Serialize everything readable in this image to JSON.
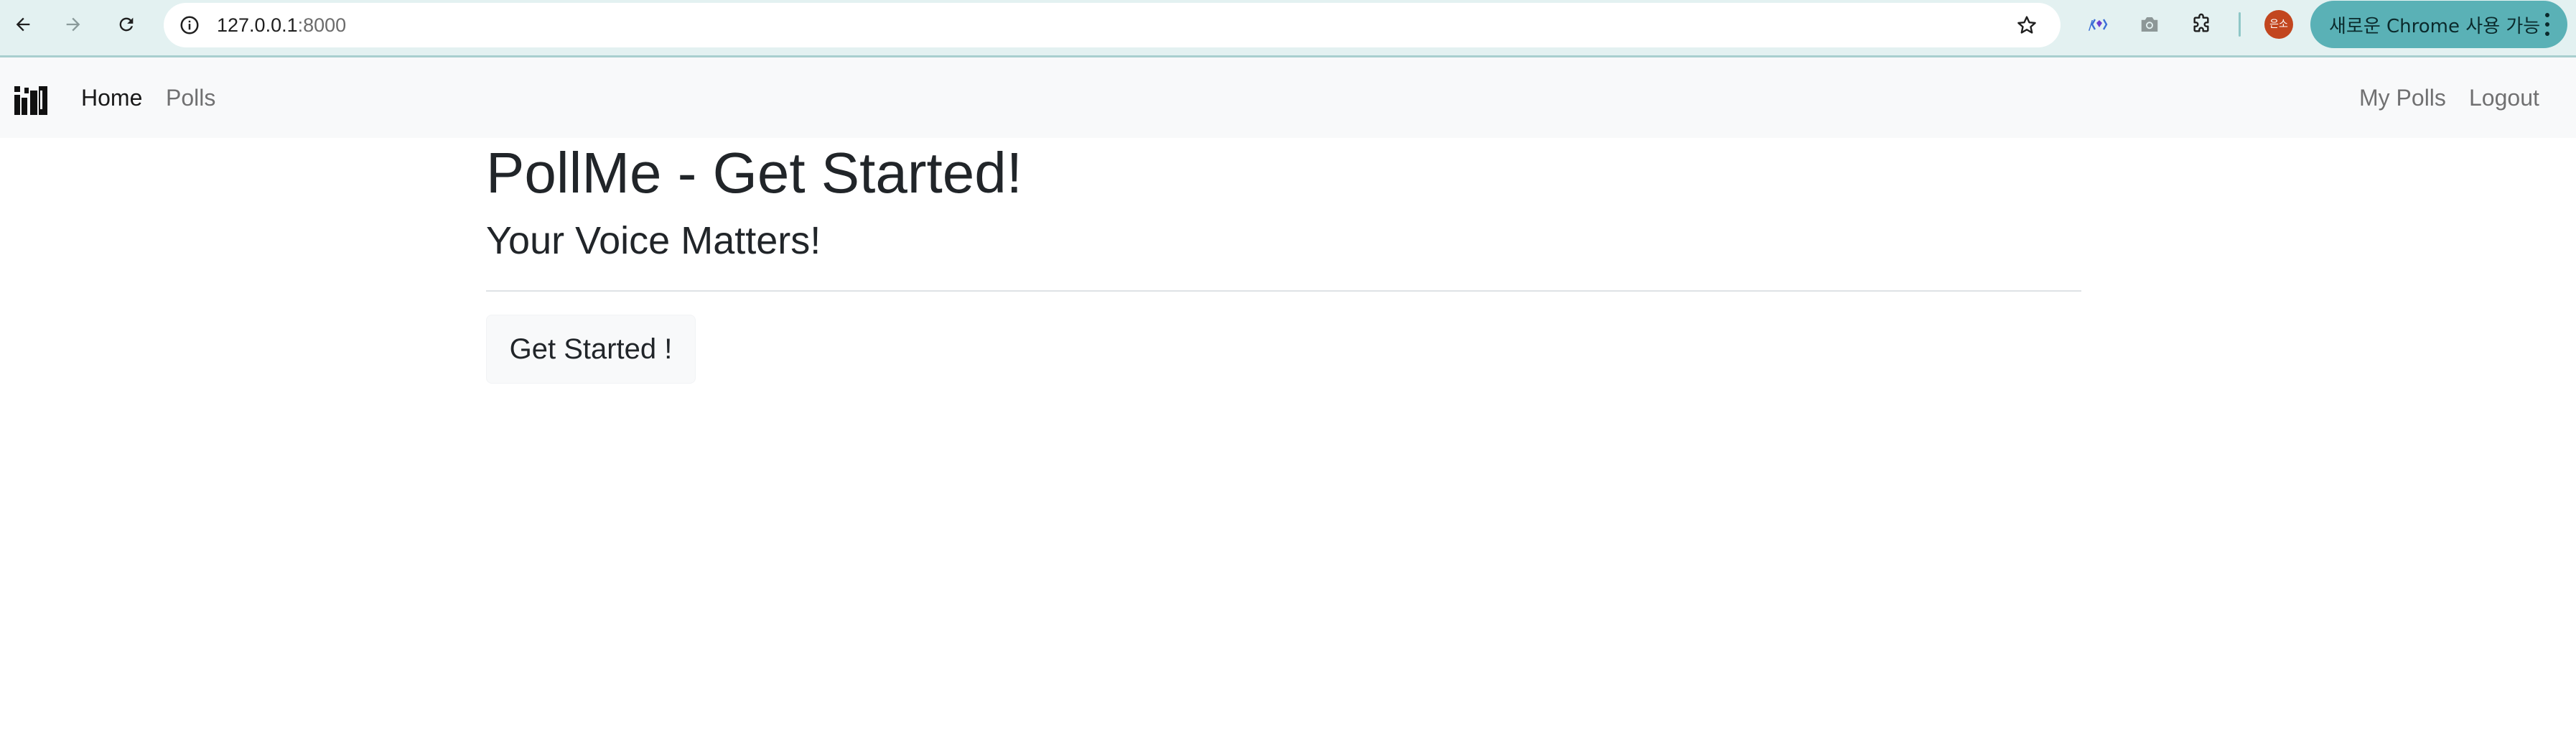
{
  "browser": {
    "url_host": "127.0.0.1",
    "url_port": ":8000",
    "profile_initials": "은소",
    "update_label": "새로운 Chrome 사용 가능",
    "icons": {
      "back": "arrow-left-icon",
      "forward": "arrow-right-icon",
      "reload": "reload-icon",
      "site_info": "info-icon",
      "bookmark": "star-icon",
      "extension_1": "code-extension-icon",
      "extension_2": "camera-icon",
      "extensions": "puzzle-icon",
      "menu": "kebab-menu-icon"
    },
    "colors": {
      "toolbar": "#e3f1f1",
      "update_pill": "#5ab1b6",
      "profile": "#c2461f"
    }
  },
  "navbar": {
    "brand_icon": "poll-logo-icon",
    "left_links": [
      {
        "label": "Home",
        "active": true
      },
      {
        "label": "Polls",
        "active": false
      }
    ],
    "right_links": [
      {
        "label": "My Polls"
      },
      {
        "label": "Logout"
      }
    ]
  },
  "main": {
    "title": "PollMe - Get Started!",
    "subtitle": "Your Voice Matters!",
    "cta_label": "Get Started !"
  }
}
